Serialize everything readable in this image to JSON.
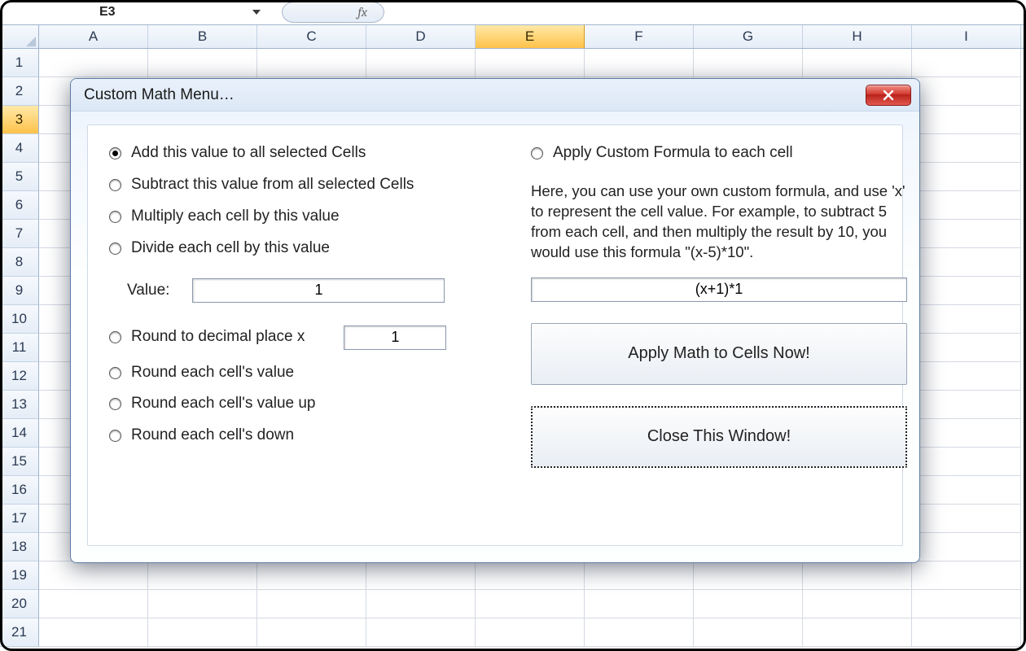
{
  "namebox": {
    "cell_ref": "E3"
  },
  "formulabar": {
    "fx_label": "fx",
    "value": ""
  },
  "columns": [
    "A",
    "B",
    "C",
    "D",
    "E",
    "F",
    "G",
    "H",
    "I"
  ],
  "selected_column": "E",
  "rows": [
    1,
    2,
    3,
    4,
    5,
    6,
    7,
    8,
    9,
    10,
    11,
    12,
    13,
    14,
    15,
    16,
    17,
    18,
    19,
    20,
    21
  ],
  "selected_row": 3,
  "dialog": {
    "title": "Custom Math Menu…",
    "left": {
      "radios": {
        "add": "Add this value to all selected Cells",
        "subtract": "Subtract this value from all selected Cells",
        "multiply": "Multiply each cell by this value",
        "divide": "Divide each cell by this value"
      },
      "selected_radio": "add",
      "value_label": "Value:",
      "value": "1",
      "round_group": {
        "round_to": "Round to decimal place x",
        "round_each": "Round each cell's value",
        "round_up": "Round each cell's value up",
        "round_down": "Round each cell's down"
      },
      "round_to_value": "1"
    },
    "right": {
      "radio_custom": "Apply Custom Formula to each cell",
      "description": "Here, you can use your own custom formula, and use 'x' to represent the cell value. For example, to subtract 5 from each cell, and then multiply the result by 10, you would use this formula \"(x-5)*10\".",
      "formula": "(x+1)*1",
      "apply_button": "Apply Math to Cells Now!",
      "close_button": "Close This Window!"
    }
  }
}
